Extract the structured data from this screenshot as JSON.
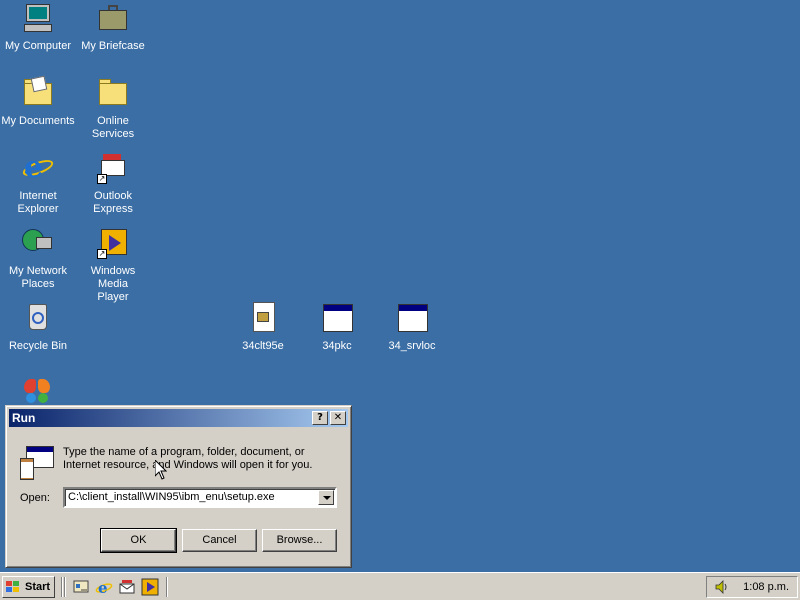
{
  "desktop": {
    "icons": [
      {
        "label": "My Computer",
        "icon": "computer-icon"
      },
      {
        "label": "My Briefcase",
        "icon": "briefcase-icon"
      },
      {
        "label": "My Documents",
        "icon": "documents-folder-icon"
      },
      {
        "label": "Online Services",
        "icon": "folder-icon"
      },
      {
        "label": "Internet Explorer",
        "icon": "internet-explorer-icon"
      },
      {
        "label": "Outlook Express",
        "icon": "outlook-express-icon"
      },
      {
        "label": "My Network Places",
        "icon": "network-places-icon"
      },
      {
        "label": "Windows Media Player",
        "icon": "media-player-icon"
      },
      {
        "label": "Recycle Bin",
        "icon": "recycle-bin-icon"
      },
      {
        "label": "34clt95e",
        "icon": "setup-file-icon"
      },
      {
        "label": "34pkc",
        "icon": "application-icon"
      },
      {
        "label": "34_srvloc",
        "icon": "application-icon"
      },
      {
        "label": "",
        "icon": "msn-butterfly-icon"
      }
    ]
  },
  "run_dialog": {
    "title": "Run",
    "help_button": "?",
    "close_button": "✕",
    "description": "Type the name of a program, folder, document, or Internet resource, and Windows will open it for you.",
    "open_label": "Open:",
    "open_value": "C:\\client_install\\WIN95\\ibm_enu\\setup.exe",
    "ok_label": "OK",
    "cancel_label": "Cancel",
    "browse_label": "Browse..."
  },
  "taskbar": {
    "start_label": "Start",
    "quick_launch": [
      "show-desktop-icon",
      "internet-explorer-icon",
      "outlook-express-icon",
      "media-player-icon"
    ],
    "clock": "1:08 p.m.",
    "tray_icons": [
      "volume-icon"
    ]
  },
  "colors": {
    "desktop": "#3a6ea5",
    "title_active_start": "#0a246a",
    "title_active_end": "#a6caf0",
    "face": "#d4d0c8"
  }
}
